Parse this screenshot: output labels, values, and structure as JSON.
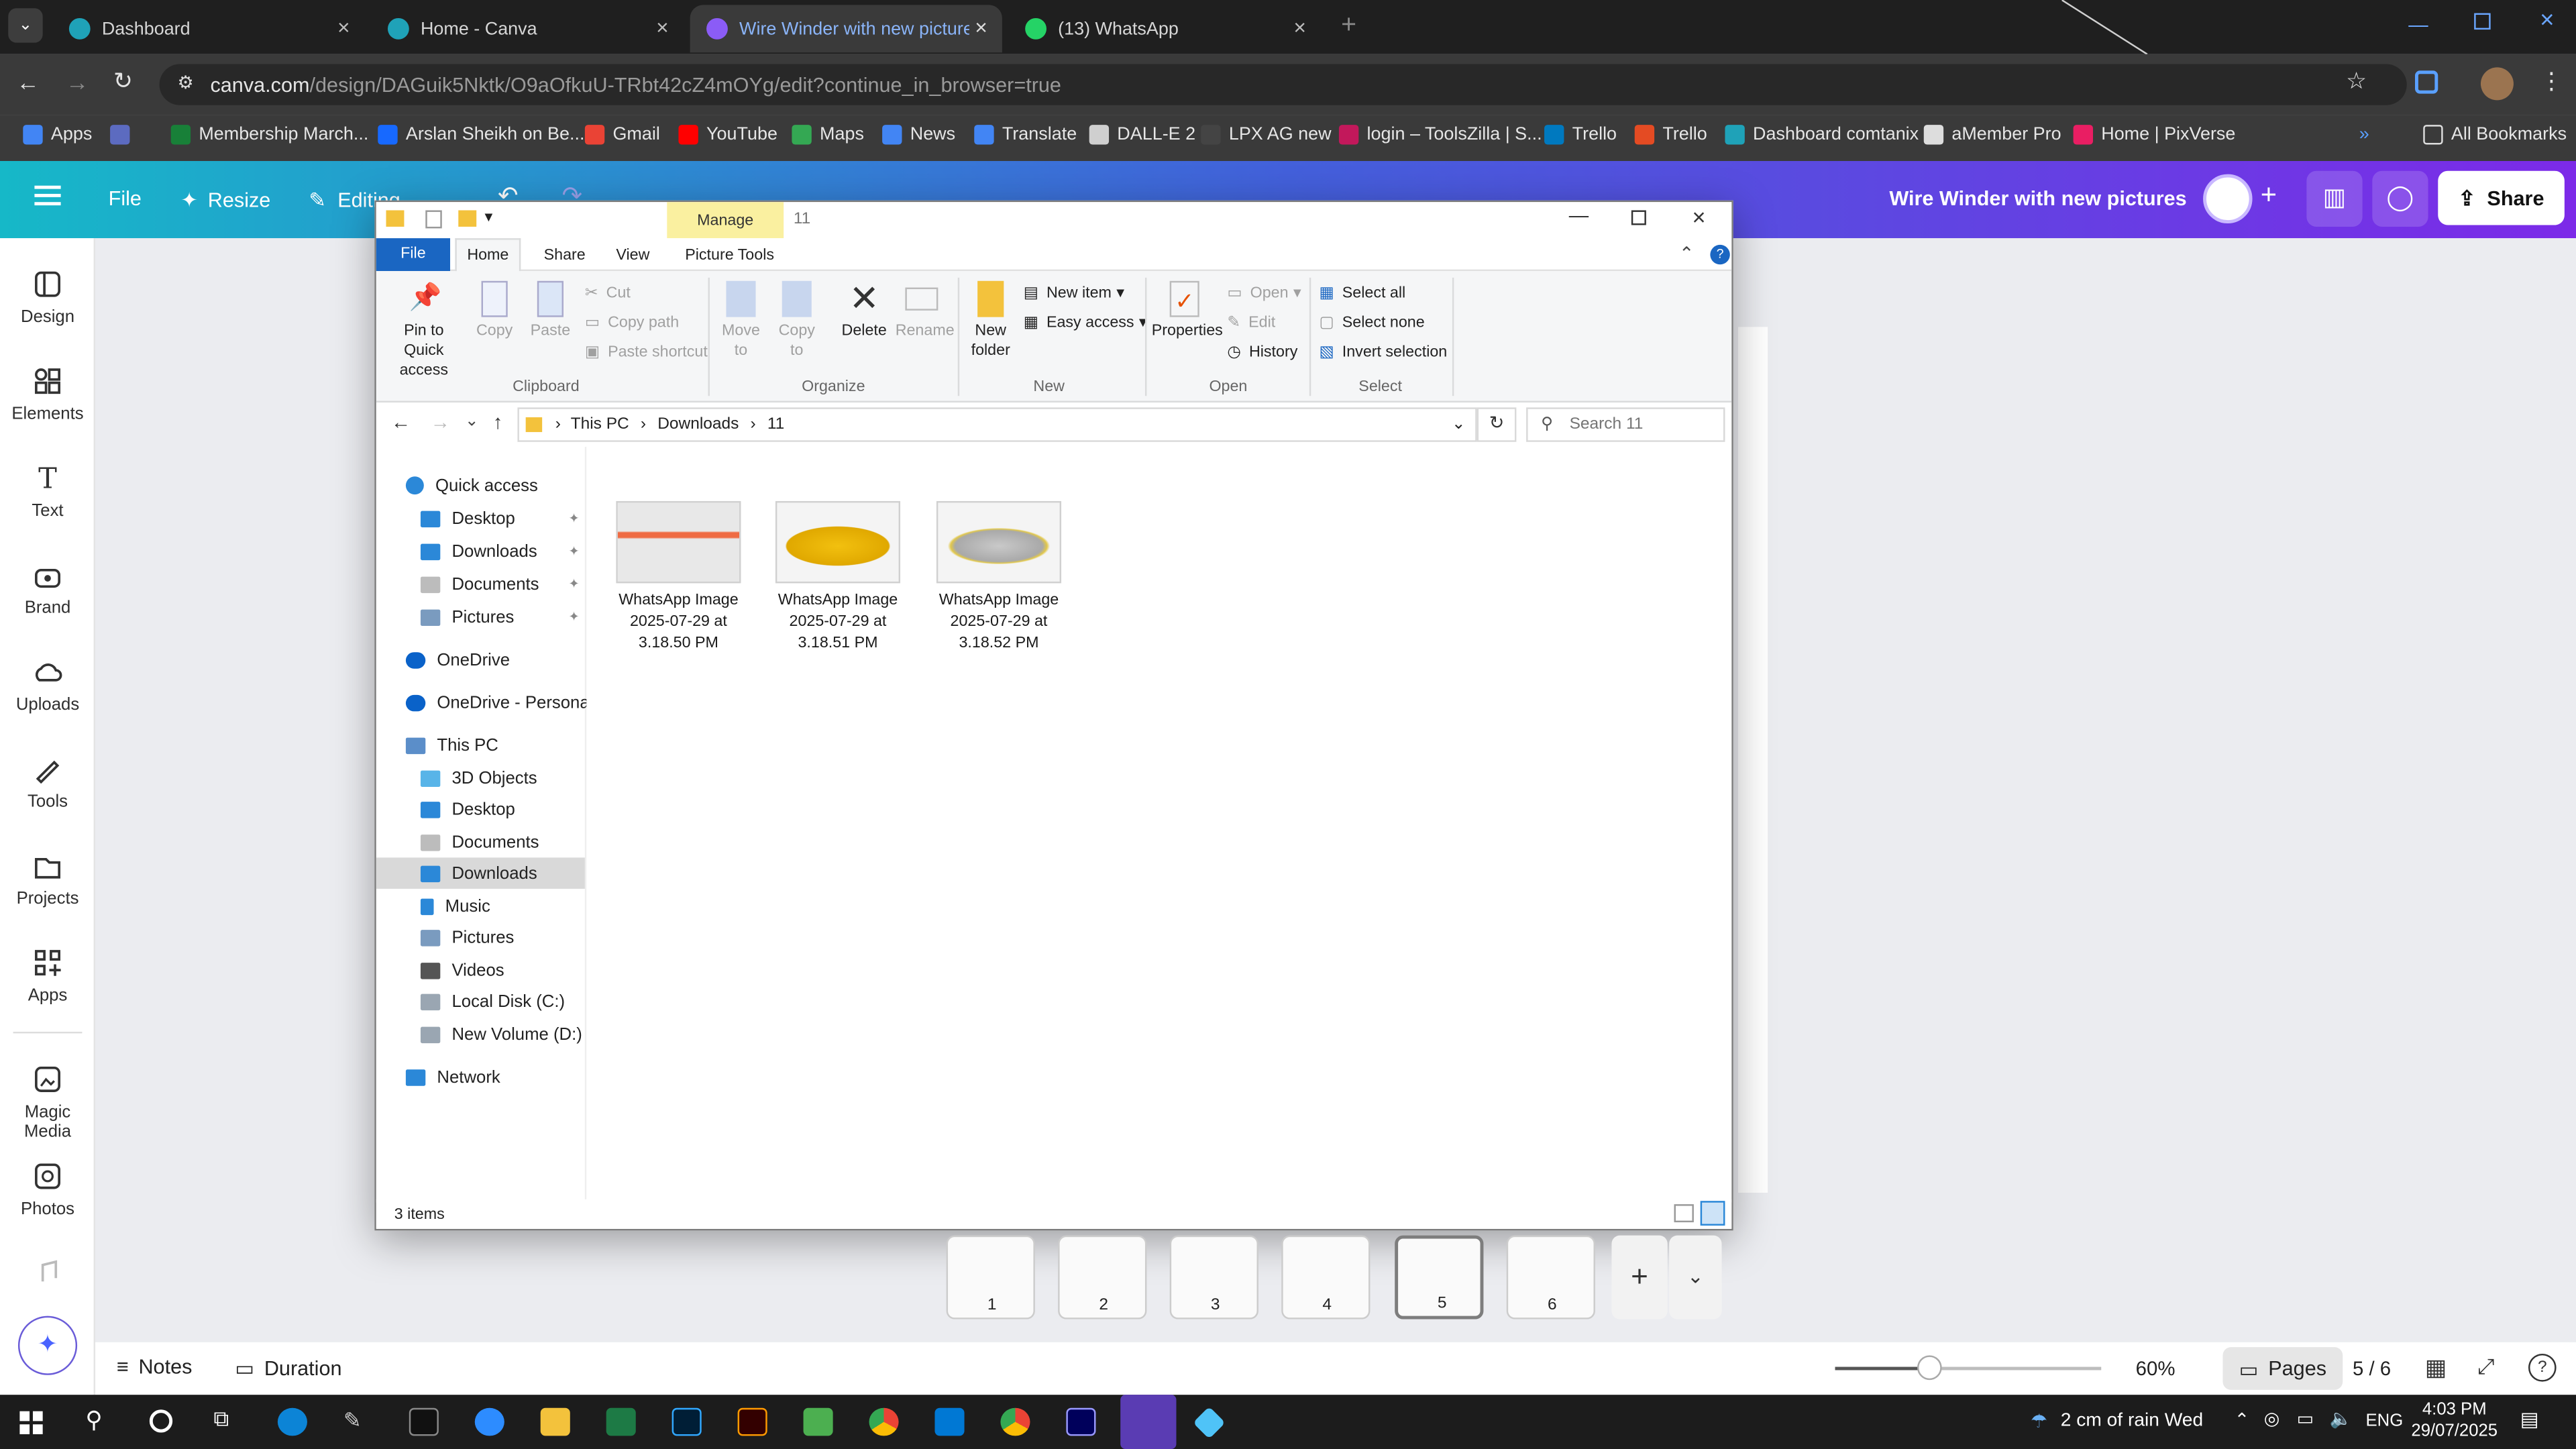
{
  "browser": {
    "tabs": [
      {
        "title": "Dashboard",
        "color": "#1fa2b8"
      },
      {
        "title": "Home - Canva",
        "color": "#1fa2b8"
      },
      {
        "title": "Wire Winder with new pictures",
        "color": "#8b5cf6"
      },
      {
        "title": "(13) WhatsApp",
        "color": "#25d366"
      }
    ],
    "url_host": "canva.com",
    "url_path": "/design/DAGuik5Nktk/O9aOfkuU-TRbt42cZ4mOYg/edit?continue_in_browser=true",
    "bookmarks": [
      "Apps",
      "Membership March...",
      "Arslan Sheikh on Be...",
      "Gmail",
      "YouTube",
      "Maps",
      "News",
      "Translate",
      "DALL-E 2",
      "LPX AG new",
      "login – ToolsZilla | S...",
      "Trello",
      "Trello",
      "Dashboard comtanix",
      "aMember Pro",
      "Home | PixVerse"
    ],
    "all_bookmarks": "All Bookmarks"
  },
  "canva": {
    "menu": {
      "file": "File",
      "resize": "Resize",
      "editing": "Editing"
    },
    "design_title": "Wire Winder with new pictures",
    "share": "Share",
    "sidebar": [
      "Design",
      "Elements",
      "Text",
      "Brand",
      "Uploads",
      "Tools",
      "Projects",
      "Apps",
      "Magic Media",
      "Photos"
    ],
    "footer": {
      "notes": "Notes",
      "duration": "Duration",
      "zoom": "60%",
      "pages": "Pages",
      "page_count": "5 / 6"
    },
    "zoom_level": 0.6,
    "thumb_numbers": [
      "1",
      "2",
      "3",
      "4",
      "5",
      "6"
    ]
  },
  "explorer": {
    "title": "11",
    "manage": "Manage",
    "tabs": [
      "File",
      "Home",
      "Share",
      "View",
      "Picture Tools"
    ],
    "clipboard": {
      "pin": "Pin to Quick access",
      "copy": "Copy",
      "paste": "Paste",
      "cut": "Cut",
      "copy_path": "Copy path",
      "paste_shortcut": "Paste shortcut",
      "group": "Clipboard"
    },
    "organize": {
      "move": "Move to",
      "copy": "Copy to",
      "delete": "Delete",
      "rename": "Rename",
      "group": "Organize"
    },
    "new_group": {
      "new_folder": "New folder",
      "new_item": "New item",
      "easy_access": "Easy access",
      "group": "New"
    },
    "open_group": {
      "properties": "Properties",
      "open": "Open",
      "edit": "Edit",
      "history": "History",
      "group": "Open"
    },
    "select_group": {
      "select_all": "Select all",
      "select_none": "Select none",
      "invert": "Invert selection",
      "group": "Select"
    },
    "breadcrumb": [
      "This PC",
      "Downloads",
      "11"
    ],
    "search_placeholder": "Search 11",
    "nav": [
      "Quick access",
      "Desktop",
      "Downloads",
      "Documents",
      "Pictures",
      "OneDrive",
      "OneDrive - Personal",
      "This PC",
      "3D Objects",
      "Desktop",
      "Documents",
      "Downloads",
      "Music",
      "Pictures",
      "Videos",
      "Local Disk (C:)",
      "New Volume (D:)",
      "Network"
    ],
    "files": [
      {
        "name1": "WhatsApp Image",
        "name2": "2025-07-29 at",
        "name3": "3.18.50 PM"
      },
      {
        "name1": "WhatsApp Image",
        "name2": "2025-07-29 at",
        "name3": "3.18.51 PM"
      },
      {
        "name1": "WhatsApp Image",
        "name2": "2025-07-29 at",
        "name3": "3.18.52 PM"
      }
    ],
    "status": "3 items"
  },
  "taskbar": {
    "weather": "2 cm of rain Wed",
    "lang": "ENG",
    "time": "4:03 PM",
    "date": "29/07/2025"
  }
}
